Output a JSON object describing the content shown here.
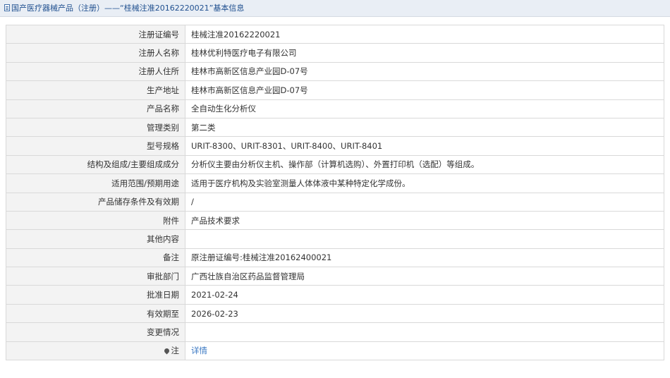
{
  "breadcrumb": {
    "icon": "document-icon",
    "text": "国产医疗器械产品（注册）——“桂械注准20162220021”基本信息"
  },
  "rows": [
    {
      "label": "注册证编号",
      "value": "桂械注准20162220021"
    },
    {
      "label": "注册人名称",
      "value": "桂林优利特医疗电子有限公司"
    },
    {
      "label": "注册人住所",
      "value": "桂林市高新区信息产业园D-07号"
    },
    {
      "label": "生产地址",
      "value": "桂林市高新区信息产业园D-07号"
    },
    {
      "label": "产品名称",
      "value": "全自动生化分析仪"
    },
    {
      "label": "管理类别",
      "value": "第二类"
    },
    {
      "label": "型号规格",
      "value": "URIT-8300、URIT-8301、URIT-8400、URIT-8401"
    },
    {
      "label": "结构及组成/主要组成成分",
      "value": "分析仪主要由分析仪主机、操作部（计算机选购）、外置打印机（选配）等组成。"
    },
    {
      "label": "适用范围/预期用途",
      "value": "适用于医疗机构及实验室测量人体体液中某种特定化学成份。"
    },
    {
      "label": "产品储存条件及有效期",
      "value": "/"
    },
    {
      "label": "附件",
      "value": "产品技术要求"
    },
    {
      "label": "其他内容",
      "value": ""
    },
    {
      "label": "备注",
      "value": "原注册证编号:桂械注准20162400021"
    },
    {
      "label": "审批部门",
      "value": "广西壮族自治区药品监督管理局"
    },
    {
      "label": "批准日期",
      "value": "2021-02-24"
    },
    {
      "label": "有效期至",
      "value": "2026-02-23"
    },
    {
      "label": "变更情况",
      "value": ""
    }
  ],
  "footer": {
    "icon": "pin-icon",
    "label": "注",
    "link_text": "详情"
  },
  "colors": {
    "topbar_bg": "#e9eef5",
    "breadcrumb_text": "#1f4f8f",
    "label_bg": "#f3f3f3",
    "border": "#d9d9d9",
    "link": "#3a78c3"
  }
}
